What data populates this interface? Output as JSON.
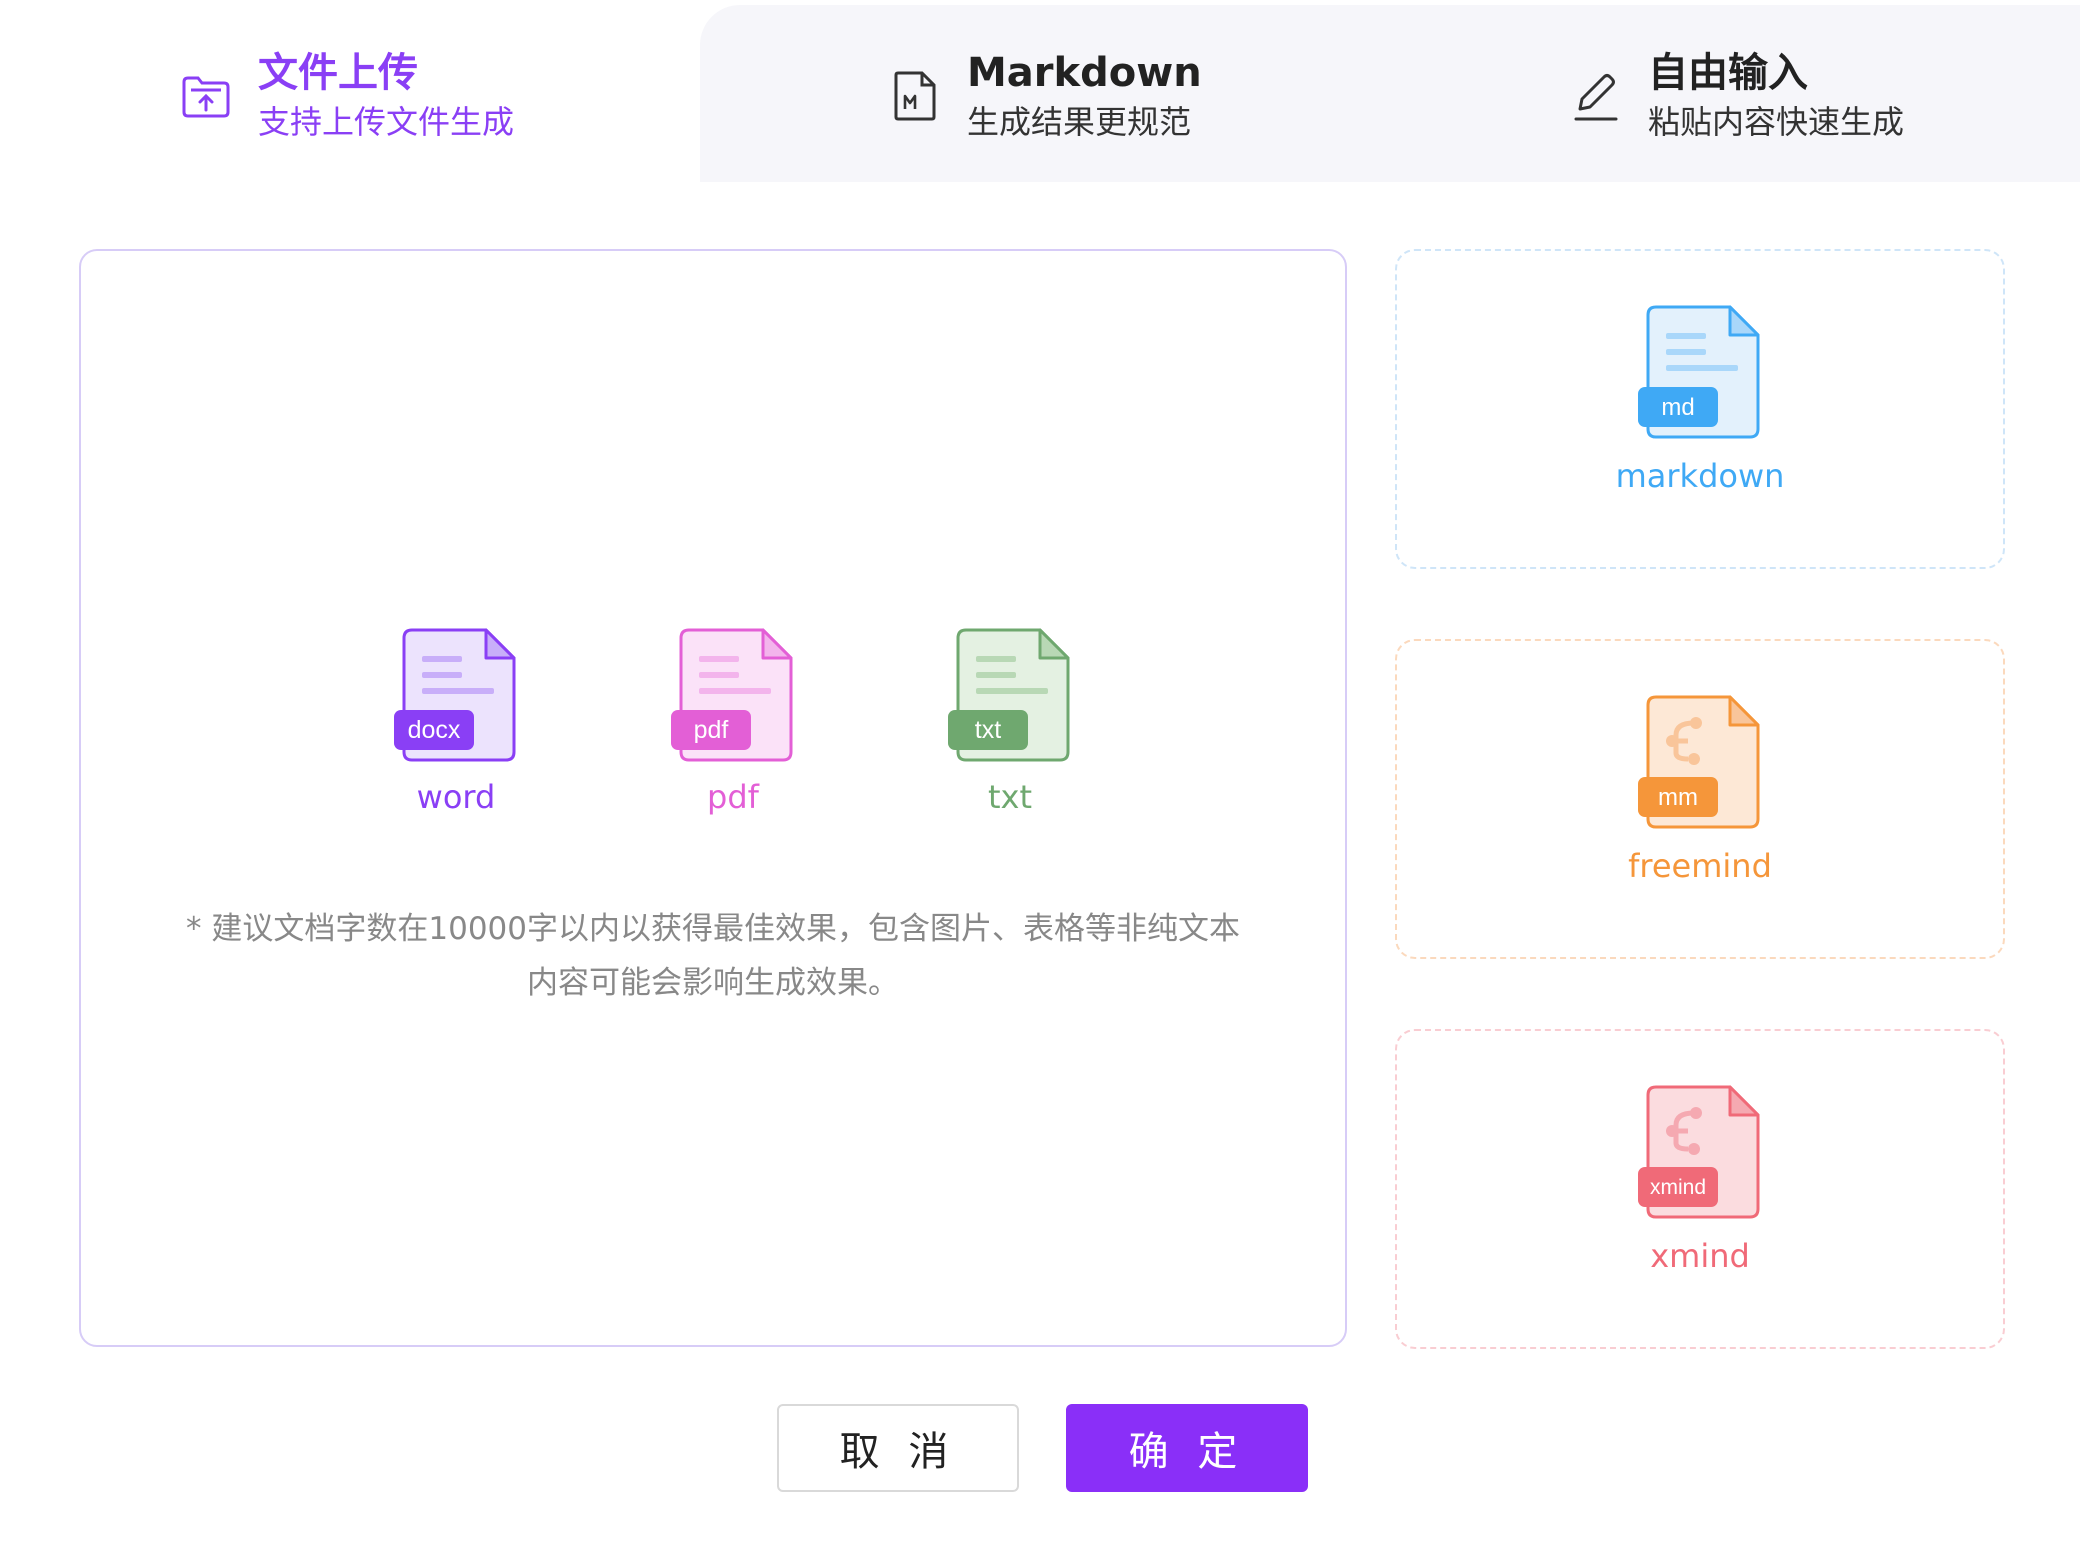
{
  "tabs": [
    {
      "title": "文件上传",
      "subtitle": "支持上传文件生成",
      "icon": "folder-upload-icon",
      "active": true
    },
    {
      "title": "Markdown",
      "subtitle": "生成结果更规范",
      "icon": "markdown-file-icon",
      "active": false
    },
    {
      "title": "自由输入",
      "subtitle": "粘贴内容快速生成",
      "icon": "pencil-icon",
      "active": false
    }
  ],
  "upload": {
    "types": [
      {
        "badge": "docx",
        "label": "word",
        "color": "#8a3ff5",
        "light": "#ece3fd"
      },
      {
        "badge": "pdf",
        "label": "pdf",
        "color": "#e35fd6",
        "light": "#fbe2f8"
      },
      {
        "badge": "txt",
        "label": "txt",
        "color": "#6fa86f",
        "light": "#e4f1e2"
      }
    ],
    "hint_line1": "* 建议文档字数在10000字以内以获得最佳效果，包含图片、表格等非纯文本",
    "hint_line2": "内容可能会影响生成效果。"
  },
  "formats": [
    {
      "badge": "md",
      "label": "markdown",
      "color": "#3fa9f5",
      "light": "#e3f1fc",
      "kind": "lines"
    },
    {
      "badge": "mm",
      "label": "freemind",
      "color": "#f5963a",
      "light": "#fde8d6",
      "kind": "tree"
    },
    {
      "badge": "xmind",
      "label": "xmind",
      "color": "#f06a78",
      "light": "#fbdcdf",
      "kind": "tree"
    }
  ],
  "buttons": {
    "cancel": "取 消",
    "ok": "确 定"
  },
  "colors": {
    "accent": "#8a2ff8"
  }
}
